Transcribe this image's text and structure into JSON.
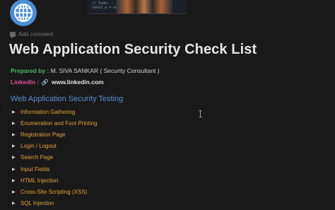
{
  "cover": {
    "code_lines": [
      "// Todo: ...",
      "const a = null"
    ]
  },
  "page": {
    "icon": "globe-icon",
    "add_comment": "Add comment",
    "title": "Web Application Security Check List"
  },
  "meta": {
    "prepared_label": "Prepared by :",
    "prepared_value": " M. SIVA SANKAR ( Security Consultant )",
    "linkedin_label": "LinkedIn :",
    "linkedin_value": "www.linkedin.com"
  },
  "section": {
    "heading": "Web Application Security Testing",
    "items": [
      "Information Gathering",
      "Enumeration and Foot Printing",
      "Registration Page",
      "Login / Logout",
      "Search Page",
      "Input Fields",
      "HTML Injection",
      "Cross-Site Scripting (XSS)",
      "SQL Injection"
    ]
  },
  "colors": {
    "background": "#191919",
    "title": "#e6e6e6",
    "prepared_label": "#4fb36a",
    "linkedin_label": "#e0509a",
    "heading": "#5b8fd6",
    "toggle_item": "#e0a23a",
    "globe": "#4a8ed8"
  }
}
